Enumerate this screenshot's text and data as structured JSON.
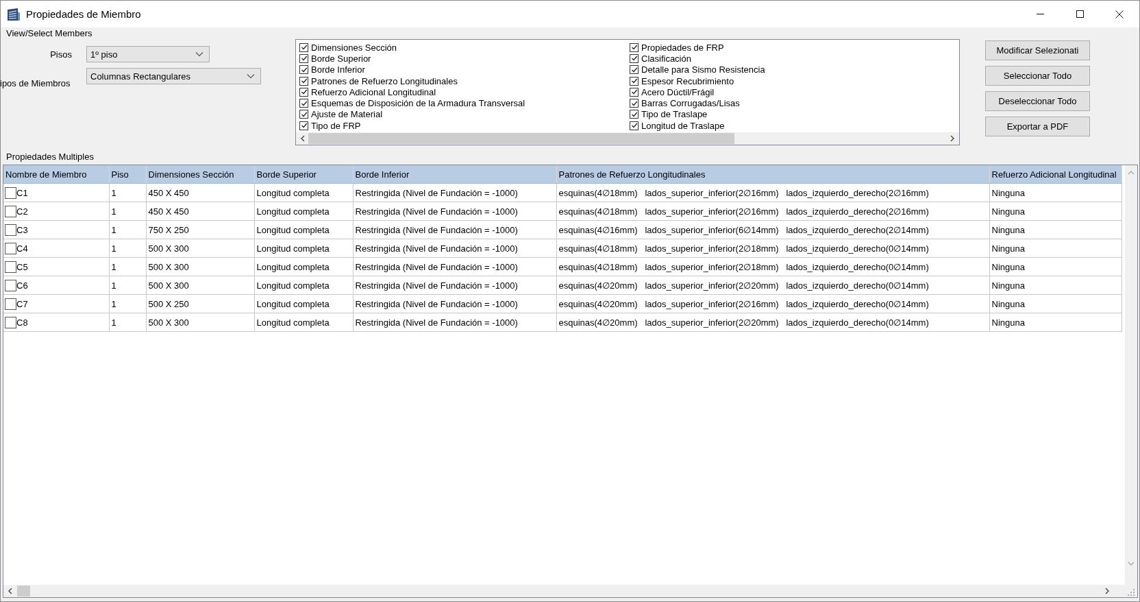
{
  "window": {
    "title": "Propiedades de Miembro"
  },
  "view_select": {
    "title": "View/Select Members",
    "floor_label": "Pisos",
    "floor_value": "1º piso",
    "type_label": "ipos de Miembros",
    "type_value": "Columnas Rectangulares"
  },
  "column_options": [
    {
      "label": "Dimensiones Sección",
      "checked": true
    },
    {
      "label": "Borde Superior",
      "checked": true
    },
    {
      "label": "Borde Inferior",
      "checked": true
    },
    {
      "label": "Patrones de Refuerzo Longitudinales",
      "checked": true
    },
    {
      "label": "Refuerzo Adicional Longitudinal",
      "checked": true
    },
    {
      "label": "Esquemas de Disposición de la Armadura Transversal",
      "checked": true
    },
    {
      "label": "Ajuste de Material",
      "checked": true
    },
    {
      "label": "Tipo de FRP",
      "checked": true
    },
    {
      "label": "Propiedades de FRP",
      "checked": true
    },
    {
      "label": "Clasificación",
      "checked": true
    },
    {
      "label": "Detalle para Sismo Resistencia",
      "checked": true
    },
    {
      "label": "Espesor Recubrimiento",
      "checked": true
    },
    {
      "label": "Acero Dúctil/Frágil",
      "checked": true
    },
    {
      "label": "Barras Corrugadas/Lisas",
      "checked": true
    },
    {
      "label": "Tipo de Traslape",
      "checked": true
    },
    {
      "label": "Longitud de Traslape",
      "checked": true
    }
  ],
  "buttons": [
    "Modificar Selezionati",
    "Seleccionar Todo",
    "Deseleccionar Todo",
    "Exportar a PDF"
  ],
  "multiple": {
    "title": "Propiedades Multiples"
  },
  "table": {
    "columns": [
      "Nombre de Miembro",
      "Piso",
      "Dimensiones Sección",
      "Borde Superior",
      "Borde Inferior",
      "Patrones de Refuerzo Longitudinales",
      "Refuerzo Adicional Longitudinal"
    ],
    "rows": [
      {
        "checked": false,
        "cells": [
          "C1",
          "1",
          "450 X 450",
          "Longitud completa",
          "Restringida (Nivel de Fundación = -1000)",
          "esquinas(4∅18mm)   lados_superior_inferior(2∅16mm)   lados_izquierdo_derecho(2∅16mm)",
          "Ninguna"
        ]
      },
      {
        "checked": false,
        "cells": [
          "C2",
          "1",
          "450 X 450",
          "Longitud completa",
          "Restringida (Nivel de Fundación = -1000)",
          "esquinas(4∅18mm)   lados_superior_inferior(2∅16mm)   lados_izquierdo_derecho(2∅16mm)",
          "Ninguna"
        ]
      },
      {
        "checked": false,
        "cells": [
          "C3",
          "1",
          "750 X 250",
          "Longitud completa",
          "Restringida (Nivel de Fundación = -1000)",
          "esquinas(4∅16mm)   lados_superior_inferior(6∅14mm)   lados_izquierdo_derecho(2∅14mm)",
          "Ninguna"
        ]
      },
      {
        "checked": false,
        "cells": [
          "C4",
          "1",
          "500 X 300",
          "Longitud completa",
          "Restringida (Nivel de Fundación = -1000)",
          "esquinas(4∅18mm)   lados_superior_inferior(2∅18mm)   lados_izquierdo_derecho(0∅14mm)",
          "Ninguna"
        ]
      },
      {
        "checked": false,
        "cells": [
          "C5",
          "1",
          "500 X 300",
          "Longitud completa",
          "Restringida (Nivel de Fundación = -1000)",
          "esquinas(4∅18mm)   lados_superior_inferior(2∅18mm)   lados_izquierdo_derecho(0∅14mm)",
          "Ninguna"
        ]
      },
      {
        "checked": false,
        "cells": [
          "C6",
          "1",
          "500 X 300",
          "Longitud completa",
          "Restringida (Nivel de Fundación = -1000)",
          "esquinas(4∅20mm)   lados_superior_inferior(2∅20mm)   lados_izquierdo_derecho(0∅14mm)",
          "Ninguna"
        ]
      },
      {
        "checked": false,
        "cells": [
          "C7",
          "1",
          "500 X 250",
          "Longitud completa",
          "Restringida (Nivel de Fundación = -1000)",
          "esquinas(4∅20mm)   lados_superior_inferior(2∅16mm)   lados_izquierdo_derecho(0∅14mm)",
          "Ninguna"
        ]
      },
      {
        "checked": false,
        "cells": [
          "C8",
          "1",
          "500 X 300",
          "Longitud completa",
          "Restringida (Nivel de Fundación = -1000)",
          "esquinas(4∅20mm)   lados_superior_inferior(2∅20mm)   lados_izquierdo_derecho(0∅14mm)",
          "Ninguna"
        ]
      }
    ]
  }
}
